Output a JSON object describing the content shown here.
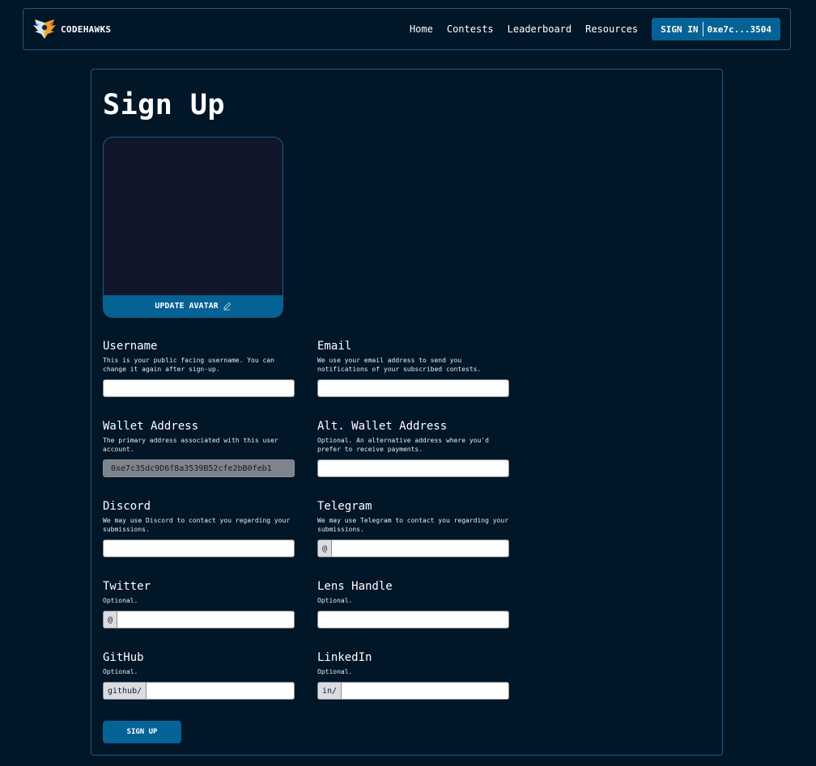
{
  "nav": {
    "brand": "CODEHAWKS",
    "links": [
      "Home",
      "Contests",
      "Leaderboard",
      "Resources"
    ],
    "signin_label": "SIGN IN",
    "wallet_short": "0xe7c...3504"
  },
  "title": "Sign Up",
  "avatar": {
    "button_label": "UPDATE AVATAR"
  },
  "fields": {
    "username": {
      "label": "Username",
      "desc": "This is your public facing username. You can change it again after sign-up.",
      "value": ""
    },
    "email": {
      "label": "Email",
      "desc": "We use your email address to send you notifications of your subscribed contests.",
      "value": ""
    },
    "wallet": {
      "label": "Wallet Address",
      "desc": "The primary address associated with this user account.",
      "value": "0xe7c35dc9D6f8a3539B52cfe2bB0feb1"
    },
    "alt_wallet": {
      "label": "Alt. Wallet Address",
      "desc": "Optional. An alternative address where you'd prefer to receive payments.",
      "value": ""
    },
    "discord": {
      "label": "Discord",
      "desc": "We may use Discord to contact you regarding your submissions.",
      "value": ""
    },
    "telegram": {
      "label": "Telegram",
      "desc": "We may use Telegram to contact you regarding your submissions.",
      "prefix": "@",
      "value": ""
    },
    "twitter": {
      "label": "Twitter",
      "desc": "Optional.",
      "prefix": "@",
      "value": ""
    },
    "lens": {
      "label": "Lens Handle",
      "desc": "Optional.",
      "value": ""
    },
    "github": {
      "label": "GitHub",
      "desc": "Optional.",
      "prefix": "github/",
      "value": ""
    },
    "linkedin": {
      "label": "LinkedIn",
      "desc": "Optional.",
      "prefix": "in/",
      "value": ""
    }
  },
  "submit_label": "SIGN UP",
  "colors": {
    "background": "#011627",
    "accent": "#046294",
    "border": "#1e5a86"
  }
}
